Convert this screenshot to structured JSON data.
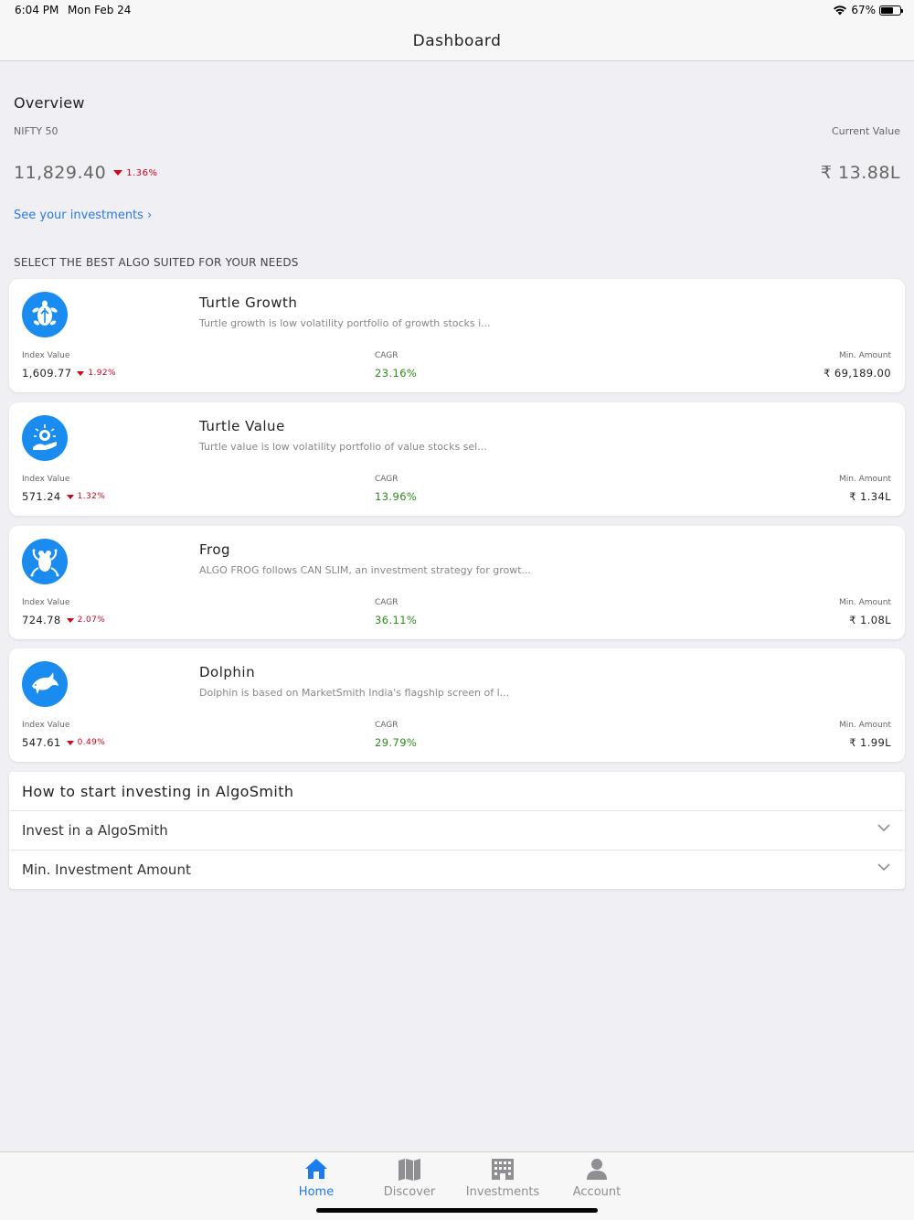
{
  "status": {
    "time": "6:04 PM",
    "date": "Mon Feb 24",
    "battery": "67%",
    "battery_level": 0.67
  },
  "header": {
    "title": "Dashboard"
  },
  "overview": {
    "title": "Overview",
    "nifty_label": "NIFTY 50",
    "nifty_value": "11,829.40",
    "nifty_change": "1.36%",
    "current_value_label": "Current Value",
    "current_value": "₹ 13.88L",
    "see_investments": "See your investments ›"
  },
  "section_label": "SELECT THE BEST ALGO SUITED FOR YOUR NEEDS",
  "labels": {
    "index_value": "Index Value",
    "cagr": "CAGR",
    "min_amount": "Min. Amount"
  },
  "algos": [
    {
      "name": "Turtle Growth",
      "icon": "turtle-icon",
      "description": "Turtle growth is low volatility portfolio of growth stocks i...",
      "index_value": "1,609.77",
      "change": "1.92%",
      "cagr": "23.16%",
      "min_amount": "₹ 69,189.00"
    },
    {
      "name": "Turtle Value",
      "icon": "turtle-value-icon",
      "description": "Turtle value is low volatility portfolio of value stocks sel...",
      "index_value": "571.24",
      "change": "1.32%",
      "cagr": "13.96%",
      "min_amount": "₹ 1.34L"
    },
    {
      "name": "Frog",
      "icon": "frog-icon",
      "description": "ALGO FROG follows CAN SLIM, an investment strategy for growt...",
      "index_value": "724.78",
      "change": "2.07%",
      "cagr": "36.11%",
      "min_amount": "₹ 1.08L"
    },
    {
      "name": "Dolphin",
      "icon": "dolphin-icon",
      "description": "Dolphin is based on MarketSmith India's flagship screen of l...",
      "index_value": "547.61",
      "change": "0.49%",
      "cagr": "29.79%",
      "min_amount": "₹ 1.99L"
    }
  ],
  "faq": {
    "title": "How to start investing in AlgoSmith",
    "items": [
      {
        "label": "Invest in a AlgoSmith"
      },
      {
        "label": "Min. Investment Amount"
      }
    ]
  },
  "tabs": [
    {
      "label": "Home",
      "icon": "home-icon",
      "active": true
    },
    {
      "label": "Discover",
      "icon": "map-icon",
      "active": false
    },
    {
      "label": "Investments",
      "icon": "building-icon",
      "active": false
    },
    {
      "label": "Account",
      "icon": "person-icon",
      "active": false
    }
  ],
  "colors": {
    "accent": "#1a7cf0",
    "negative": "#d0021b",
    "positive": "#2e8b1e",
    "background": "#efeff4"
  }
}
